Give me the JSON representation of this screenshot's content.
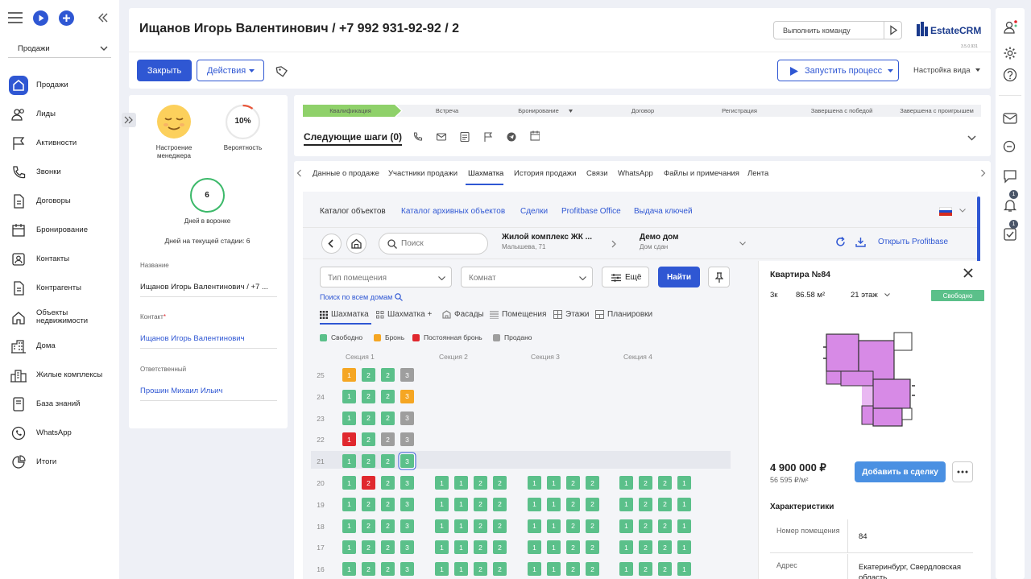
{
  "sidebar": {
    "module": "Продажи",
    "items": [
      {
        "label": "Продажи",
        "icon": "home-icon",
        "active": true
      },
      {
        "label": "Лиды",
        "icon": "users-icon"
      },
      {
        "label": "Активности",
        "icon": "flag-icon"
      },
      {
        "label": "Звонки",
        "icon": "phone-icon"
      },
      {
        "label": "Договоры",
        "icon": "document-icon"
      },
      {
        "label": "Бронирование",
        "icon": "calendar-icon"
      },
      {
        "label": "Контакты",
        "icon": "contact-card-icon"
      },
      {
        "label": "Контрагенты",
        "icon": "document-icon"
      },
      {
        "label": "Объекты недвижимости",
        "icon": "house-icon"
      },
      {
        "label": "Дома",
        "icon": "building-icon"
      },
      {
        "label": "Жилые комплексы",
        "icon": "buildings-icon"
      },
      {
        "label": "База знаний",
        "icon": "book-icon"
      },
      {
        "label": "WhatsApp",
        "icon": "whatsapp-icon"
      },
      {
        "label": "Итоги",
        "icon": "pie-chart-icon"
      }
    ]
  },
  "header": {
    "title": "Ищанов Игорь Валентинович / +7 992 931-92-92 / 2",
    "command_placeholder": "Выполнить команду",
    "logo_text": "EstateCRM",
    "version": "3.5.0.931",
    "close_label": "Закрыть",
    "actions_label": "Действия",
    "run_process_label": "Запустить процесс",
    "view_settings_label": "Настройка вида"
  },
  "info": {
    "mood_label": "Настроение менеджера",
    "probability": "10%",
    "probability_value": 0.1,
    "probability_label": "Вероятность",
    "days_in_funnel": "6",
    "days_in_funnel_label": "Дней в воронке",
    "days_on_stage": "Дней на текущей стадии: 6",
    "name_label": "Название",
    "name_value": "Ищанов Игорь Валентинович / +7 ...",
    "contact_label": "Контакт",
    "contact_value": "Ищанов Игорь Валентинович",
    "responsible_label": "Ответственный",
    "responsible_value": "Прошин Михаил Ильич"
  },
  "pipeline": {
    "stages": [
      "Квалификация",
      "Встреча",
      "Бронирование",
      "Договор",
      "Регистрация",
      "Завершена с победой",
      "Завершена с проигрышем"
    ],
    "next_steps": "Следующие шаги (0)",
    "colors": {
      "active_stage": "#8fd16a",
      "inactive_stage": "#f0f1f4"
    }
  },
  "tabs": [
    "Данные о продаже",
    "Участники продажи",
    "Шахматка",
    "История продажи",
    "Связи",
    "WhatsApp",
    "Файлы и примечания",
    "Лента"
  ],
  "catalog": {
    "tabs": [
      "Каталог объектов",
      "Каталог архивных объектов",
      "Сделки",
      "Profitbase Office",
      "Выдача ключей"
    ],
    "search_placeholder": "Поиск",
    "complex_name": "Жилой комплекс ЖК ...",
    "complex_address": "Малышева, 71",
    "house_name": "Демо дом",
    "house_status": "Дом сдан",
    "open_profitbase": "Открыть Profitbase",
    "filters": {
      "room_type": "Тип помещения",
      "rooms": "Комнат",
      "more": "Ещё",
      "find": "Найти"
    },
    "search_all": "Поиск по всем домам",
    "view_tabs": [
      "Шахматка",
      "Шахматка +",
      "Фасады",
      "Помещения",
      "Этажи",
      "Планировки"
    ],
    "legend": [
      {
        "label": "Свободно",
        "color": "#5bc08a"
      },
      {
        "label": "Бронь",
        "color": "#f5a623"
      },
      {
        "label": "Постоянная бронь",
        "color": "#e0282e"
      },
      {
        "label": "Продано",
        "color": "#9e9e9e"
      }
    ],
    "sections": [
      "Секция 1",
      "Секция 2",
      "Секция 3",
      "Секция 4"
    ],
    "floors": [
      {
        "floor": "25",
        "sections": [
          [
            {
              "r": "1",
              "s": "b"
            },
            {
              "r": "2",
              "s": "f"
            },
            {
              "r": "2",
              "s": "f"
            },
            {
              "r": "3",
              "s": "s"
            }
          ]
        ]
      },
      {
        "floor": "24",
        "sections": [
          [
            {
              "r": "1",
              "s": "f"
            },
            {
              "r": "2",
              "s": "f"
            },
            {
              "r": "2",
              "s": "f"
            },
            {
              "r": "3",
              "s": "b"
            }
          ]
        ]
      },
      {
        "floor": "23",
        "sections": [
          [
            {
              "r": "1",
              "s": "f"
            },
            {
              "r": "2",
              "s": "f"
            },
            {
              "r": "2",
              "s": "f"
            },
            {
              "r": "3",
              "s": "s"
            }
          ]
        ]
      },
      {
        "floor": "22",
        "sections": [
          [
            {
              "r": "1",
              "s": "p"
            },
            {
              "r": "2",
              "s": "f"
            },
            {
              "r": "2",
              "s": "s"
            },
            {
              "r": "3",
              "s": "s"
            }
          ]
        ]
      },
      {
        "floor": "21",
        "highlight": true,
        "sections": [
          [
            {
              "r": "1",
              "s": "f"
            },
            {
              "r": "2",
              "s": "f"
            },
            {
              "r": "2",
              "s": "f"
            },
            {
              "r": "3",
              "s": "f",
              "sel": true
            }
          ]
        ]
      },
      {
        "floor": "20",
        "sections": [
          [
            {
              "r": "1",
              "s": "f"
            },
            {
              "r": "2",
              "s": "p"
            },
            {
              "r": "2",
              "s": "f"
            },
            {
              "r": "3",
              "s": "f"
            }
          ],
          [
            {
              "r": "1",
              "s": "f"
            },
            {
              "r": "1",
              "s": "f"
            },
            {
              "r": "2",
              "s": "f"
            },
            {
              "r": "2",
              "s": "f"
            }
          ],
          [
            {
              "r": "1",
              "s": "f"
            },
            {
              "r": "1",
              "s": "f"
            },
            {
              "r": "2",
              "s": "f"
            },
            {
              "r": "2",
              "s": "f"
            }
          ],
          [
            {
              "r": "1",
              "s": "f"
            },
            {
              "r": "2",
              "s": "f"
            },
            {
              "r": "2",
              "s": "f"
            },
            {
              "r": "1",
              "s": "f"
            }
          ]
        ]
      },
      {
        "floor": "19",
        "sections": [
          [
            {
              "r": "1",
              "s": "f"
            },
            {
              "r": "2",
              "s": "f"
            },
            {
              "r": "2",
              "s": "f"
            },
            {
              "r": "3",
              "s": "f"
            }
          ],
          [
            {
              "r": "1",
              "s": "f"
            },
            {
              "r": "1",
              "s": "f"
            },
            {
              "r": "2",
              "s": "f"
            },
            {
              "r": "2",
              "s": "f"
            }
          ],
          [
            {
              "r": "1",
              "s": "f"
            },
            {
              "r": "1",
              "s": "f"
            },
            {
              "r": "2",
              "s": "f"
            },
            {
              "r": "2",
              "s": "f"
            }
          ],
          [
            {
              "r": "1",
              "s": "f"
            },
            {
              "r": "2",
              "s": "f"
            },
            {
              "r": "2",
              "s": "f"
            },
            {
              "r": "1",
              "s": "f"
            }
          ]
        ]
      },
      {
        "floor": "18",
        "sections": [
          [
            {
              "r": "1",
              "s": "f"
            },
            {
              "r": "2",
              "s": "f"
            },
            {
              "r": "2",
              "s": "f"
            },
            {
              "r": "3",
              "s": "f"
            }
          ],
          [
            {
              "r": "1",
              "s": "f"
            },
            {
              "r": "1",
              "s": "f"
            },
            {
              "r": "2",
              "s": "f"
            },
            {
              "r": "2",
              "s": "f"
            }
          ],
          [
            {
              "r": "1",
              "s": "f"
            },
            {
              "r": "1",
              "s": "f"
            },
            {
              "r": "2",
              "s": "f"
            },
            {
              "r": "2",
              "s": "f"
            }
          ],
          [
            {
              "r": "1",
              "s": "f"
            },
            {
              "r": "2",
              "s": "f"
            },
            {
              "r": "2",
              "s": "f"
            },
            {
              "r": "1",
              "s": "f"
            }
          ]
        ]
      },
      {
        "floor": "17",
        "sections": [
          [
            {
              "r": "1",
              "s": "f"
            },
            {
              "r": "2",
              "s": "f"
            },
            {
              "r": "2",
              "s": "f"
            },
            {
              "r": "3",
              "s": "f"
            }
          ],
          [
            {
              "r": "1",
              "s": "f"
            },
            {
              "r": "1",
              "s": "f"
            },
            {
              "r": "2",
              "s": "f"
            },
            {
              "r": "2",
              "s": "f"
            }
          ],
          [
            {
              "r": "1",
              "s": "f"
            },
            {
              "r": "1",
              "s": "f"
            },
            {
              "r": "2",
              "s": "f"
            },
            {
              "r": "2",
              "s": "f"
            }
          ],
          [
            {
              "r": "1",
              "s": "f"
            },
            {
              "r": "2",
              "s": "f"
            },
            {
              "r": "2",
              "s": "f"
            },
            {
              "r": "1",
              "s": "f"
            }
          ]
        ]
      },
      {
        "floor": "16",
        "sections": [
          [
            {
              "r": "1",
              "s": "f"
            },
            {
              "r": "2",
              "s": "f"
            },
            {
              "r": "2",
              "s": "f"
            },
            {
              "r": "3",
              "s": "f"
            }
          ],
          [
            {
              "r": "1",
              "s": "f"
            },
            {
              "r": "1",
              "s": "f"
            },
            {
              "r": "2",
              "s": "f"
            },
            {
              "r": "2",
              "s": "f"
            }
          ],
          [
            {
              "r": "1",
              "s": "f"
            },
            {
              "r": "1",
              "s": "f"
            },
            {
              "r": "2",
              "s": "f"
            },
            {
              "r": "2",
              "s": "f"
            }
          ],
          [
            {
              "r": "1",
              "s": "f"
            },
            {
              "r": "2",
              "s": "f"
            },
            {
              "r": "2",
              "s": "f"
            },
            {
              "r": "1",
              "s": "f"
            }
          ]
        ]
      }
    ]
  },
  "flat": {
    "title": "Квартира №84",
    "rooms": "3к",
    "area": "86.58 м²",
    "floor": "21 этаж",
    "status": "Свободно",
    "price": "4 900 000 ₽",
    "price_per_m2": "56 595 ₽/м²",
    "add_to_deal": "Добавить в сделку",
    "characteristics_title": "Характеристики",
    "characteristics": [
      {
        "label": "Номер помещения",
        "value": "84"
      },
      {
        "label": "Адрес",
        "value": "Екатеринбург, Свердловская область,"
      }
    ]
  }
}
